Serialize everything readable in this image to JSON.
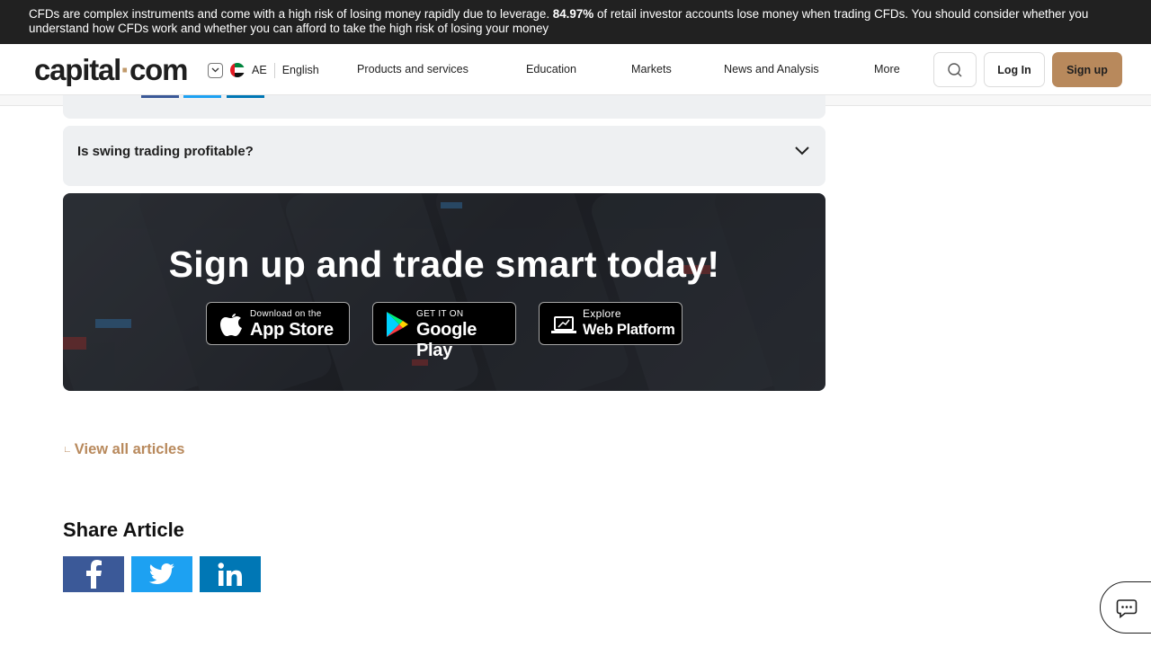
{
  "risk_banner": {
    "text_before": "CFDs are complex instruments and come with a high risk of losing money rapidly due to leverage.",
    "percentage": "84.97%",
    "text_after": "of retail investor accounts lose money when trading CFDs. You should consider whether you understand how CFDs work and whether you can afford to take the high risk of losing your money"
  },
  "header": {
    "logo_text_a": "capital",
    "logo_dot": "·",
    "logo_text_b": "com",
    "region_code": "AE",
    "language": "English",
    "nav": [
      {
        "label": "Products and services"
      },
      {
        "label": "Education"
      },
      {
        "label": "Markets"
      },
      {
        "label": "News and Analysis"
      },
      {
        "label": "More"
      }
    ],
    "login_label": "Log In",
    "signup_label": "Sign up"
  },
  "faq": {
    "question": "Is swing trading profitable?"
  },
  "promo": {
    "title": "Sign up and trade smart today!",
    "app_store": {
      "small": "Download on the",
      "big": "App Store"
    },
    "google_play": {
      "small": "GET IT ON",
      "big": "Google Play"
    },
    "web_platform": {
      "small": "Explore",
      "big": "Web Platform"
    }
  },
  "view_all_label": "View all articles",
  "share": {
    "title": "Share Article"
  },
  "colors": {
    "accent": "#b8895c",
    "banner_bg": "#212121",
    "faq_bg": "#eef0f2",
    "facebook": "#3b5998",
    "twitter": "#1da1f2",
    "linkedin": "#0077b5"
  }
}
